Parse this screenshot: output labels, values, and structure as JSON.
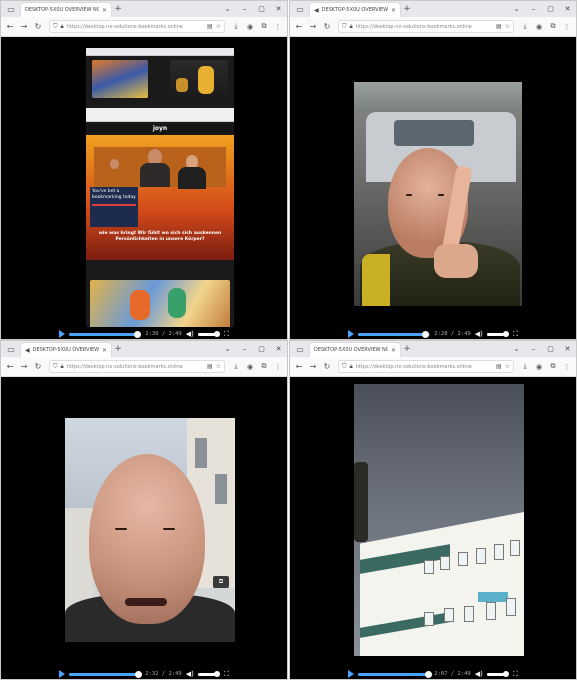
{
  "windows": [
    {
      "tab_title": "DESKTOP-5X0U OVERVIEW NOW",
      "url": "https://desktop.nx-solutions-bookmarks.online",
      "video_page": {
        "joyn_logo": "joyn",
        "popup_text": "You've bet a bookmarking today",
        "popup_button": "",
        "headline": "wie was bringt Wir fühlt wo sich sich auskennen Persönlichkeiten in unsere Körper?",
        "subline": ""
      },
      "time": "2:30 / 2:49",
      "progress": 0.95
    },
    {
      "tab_title": "DESKTOP-5X0U OVERVIEW NOW",
      "url": "https://desktop.nx-solutions-bookmarks.online",
      "time": "2:28 / 2:49",
      "progress": 0.94
    },
    {
      "tab_title": "DESKTOP-5X0U OVERVIEW NOW",
      "url": "https://desktop.nx-solutions-bookmarks.online",
      "time": "2:32 / 2:49",
      "progress": 0.96
    },
    {
      "tab_title": "DESKTOP-5X0U OVERVIEW NOW",
      "url": "https://desktop.nx-solutions-bookmarks.online",
      "time": "2:07 / 2:49",
      "progress": 0.97
    }
  ],
  "colors": {
    "accent": "#4aa3ff",
    "chrome_bg": "#e8e8ec"
  },
  "icons": {
    "window_menu": "window-icon",
    "speaker": "speaker-icon",
    "close": "close-icon",
    "new_tab": "plus-icon",
    "back": "arrow-left-icon",
    "forward": "arrow-right-icon",
    "reload": "reload-icon",
    "shield": "shield-icon",
    "lock": "lock-icon",
    "bookmark": "star-icon",
    "extensions": "puzzle-icon",
    "downloads": "download-icon",
    "account": "account-icon",
    "play": "play-icon",
    "volume": "volume-icon",
    "fullscreen": "fullscreen-icon"
  }
}
